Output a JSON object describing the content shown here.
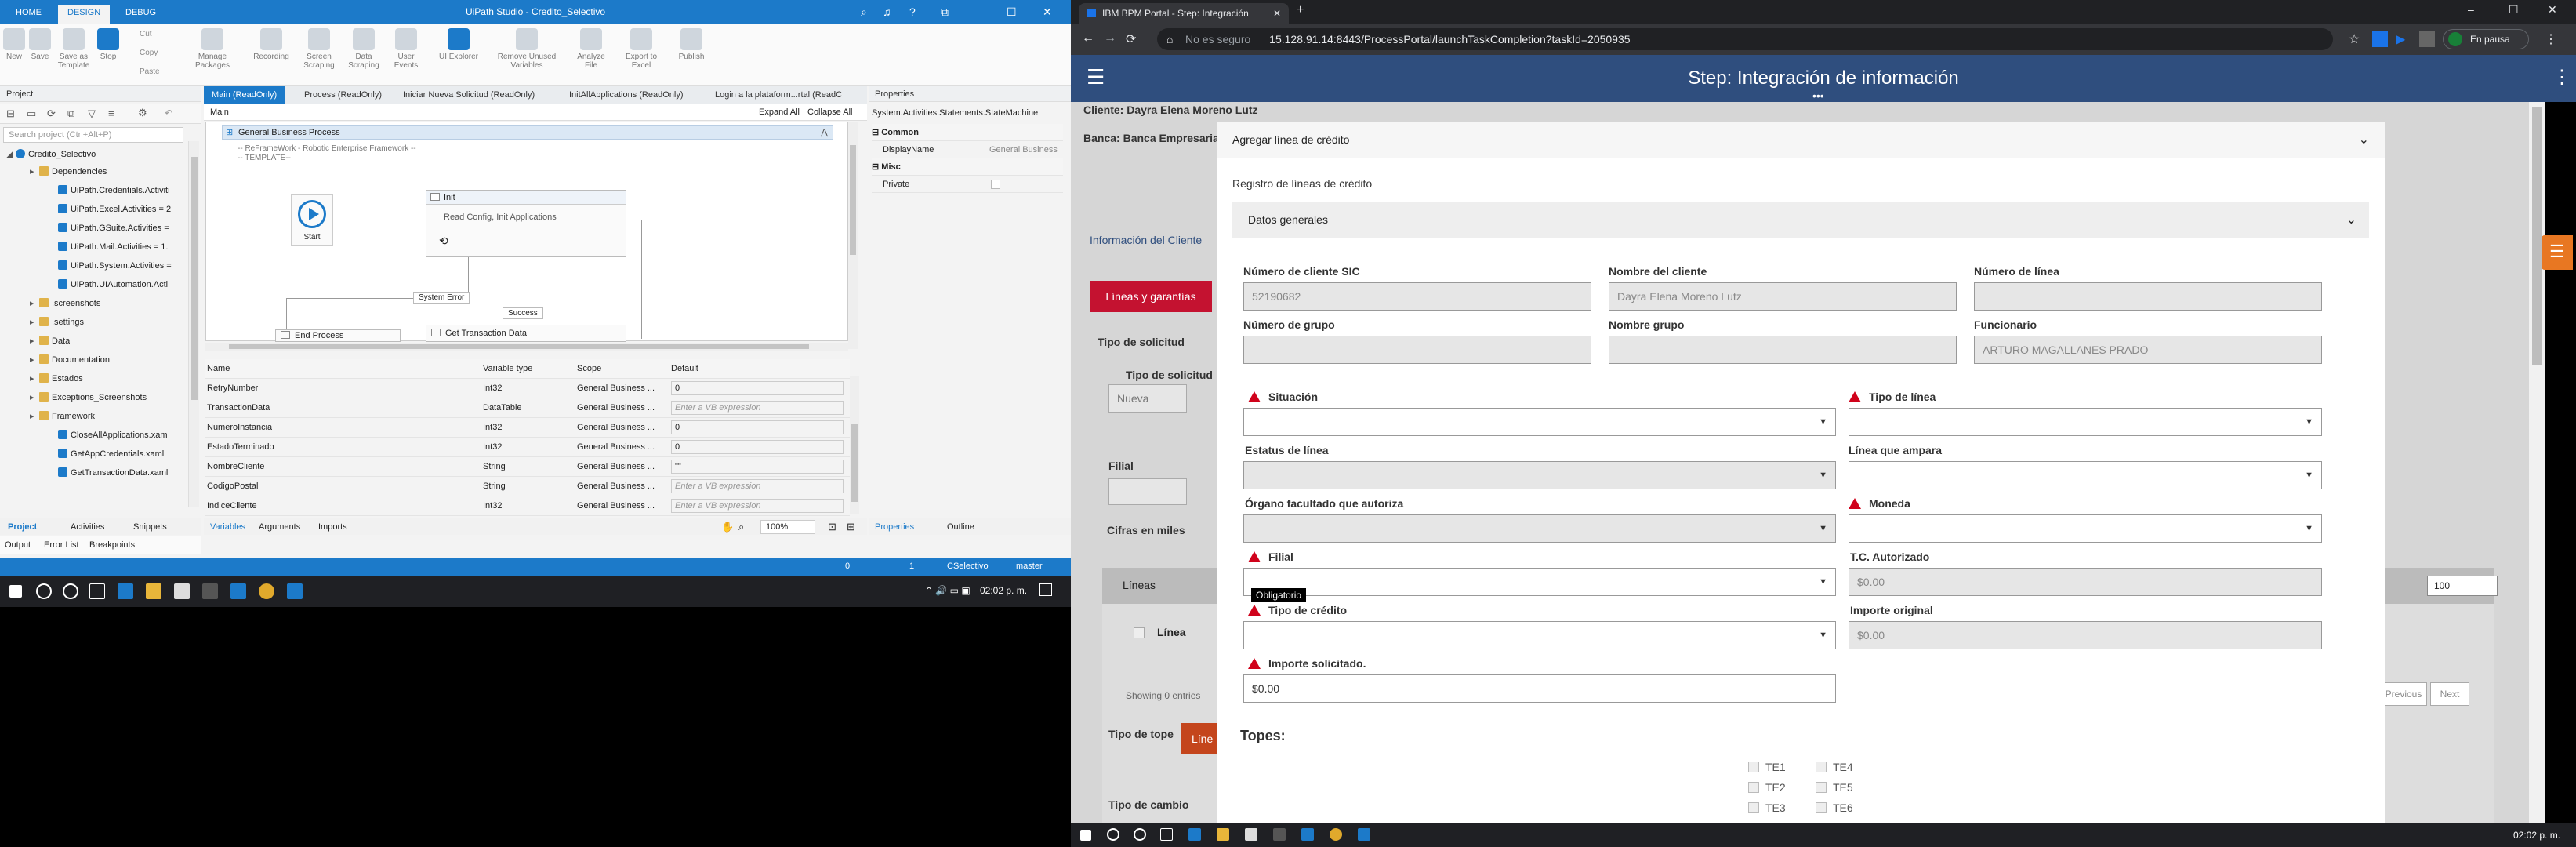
{
  "uipath": {
    "tabs": [
      "HOME",
      "DESIGN",
      "DEBUG"
    ],
    "title": "UiPath Studio - Credito_Selectivo",
    "ribbon": {
      "new": "New",
      "save": "Save",
      "save_as": "Save as Template",
      "stop": "Stop",
      "cut": "Cut",
      "copy": "Copy",
      "paste": "Paste",
      "manage": "Manage Packages",
      "recording": "Recording",
      "screen": "Screen Scraping",
      "data": "Data Scraping",
      "user": "User Events",
      "explorer": "UI Explorer",
      "remove": "Remove Unused Variables",
      "analyze": "Analyze File",
      "export": "Export to Excel",
      "publish": "Publish"
    },
    "project": {
      "header": "Project",
      "search": "Search project (Ctrl+Alt+P)",
      "root": "Credito_Selectivo",
      "items": [
        {
          "label": "Dependencies",
          "kind": "fold",
          "level": 1
        },
        {
          "label": "UiPath.Credentials.Activiti",
          "kind": "pkg",
          "level": 2
        },
        {
          "label": "UiPath.Excel.Activities = 2",
          "kind": "pkg",
          "level": 2
        },
        {
          "label": "UiPath.GSuite.Activities =",
          "kind": "pkg",
          "level": 2
        },
        {
          "label": "UiPath.Mail.Activities = 1.",
          "kind": "pkg",
          "level": 2
        },
        {
          "label": "UiPath.System.Activities =",
          "kind": "pkg",
          "level": 2
        },
        {
          "label": "UiPath.UIAutomation.Acti",
          "kind": "pkg",
          "level": 2
        },
        {
          "label": ".screenshots",
          "kind": "fold",
          "level": 1
        },
        {
          "label": ".settings",
          "kind": "fold",
          "level": 1
        },
        {
          "label": "Data",
          "kind": "fold",
          "level": 1
        },
        {
          "label": "Documentation",
          "kind": "fold",
          "level": 1
        },
        {
          "label": "Estados",
          "kind": "fold",
          "level": 1
        },
        {
          "label": "Exceptions_Screenshots",
          "kind": "fold",
          "level": 1
        },
        {
          "label": "Framework",
          "kind": "fold",
          "level": 1
        },
        {
          "label": "CloseAllApplications.xam",
          "kind": "xaml",
          "level": 2
        },
        {
          "label": "GetAppCredentials.xaml",
          "kind": "xaml",
          "level": 2
        },
        {
          "label": "GetTransactionData.xaml",
          "kind": "xaml",
          "level": 2
        }
      ],
      "bottom_tabs": [
        "Project",
        "Activities",
        "Snippets"
      ],
      "footer_tabs": [
        "Output",
        "Error List",
        "Breakpoints"
      ]
    },
    "doc_tabs": [
      "Main (ReadOnly)",
      "Process (ReadOnly)",
      "Iniciar Nueva Solicitud (ReadOnly)",
      "InitAllApplications (ReadOnly)",
      "Login a la plataform...rtal (ReadC"
    ],
    "breadcrumb": "Main",
    "expand_all": "Expand All",
    "collapse_all": "Collapse All",
    "workflow": {
      "container": "General Business Process",
      "comment1": "-- ReFrameWork - Robotic Enterprise Framework --",
      "comment2": "-- TEMPLATE--",
      "start": "Start",
      "init_title": "Init",
      "init_body": "Read Config, Init Applications",
      "system_error": "System Error",
      "success": "Success",
      "end": "End Process",
      "get": "Get Transaction Data"
    },
    "vars": {
      "headers": [
        "Name",
        "Variable type",
        "Scope",
        "Default"
      ],
      "rows": [
        [
          "RetryNumber",
          "Int32",
          "General Business ...",
          "0"
        ],
        [
          "TransactionData",
          "DataTable",
          "General Business ...",
          "Enter a VB expression"
        ],
        [
          "NumeroInstancia",
          "Int32",
          "General Business ...",
          "0"
        ],
        [
          "EstadoTerminado",
          "Int32",
          "General Business ...",
          "0"
        ],
        [
          "NombreCliente",
          "String",
          "General Business ...",
          "\"\""
        ],
        [
          "CodigoPostal",
          "String",
          "General Business ...",
          "Enter a VB expression"
        ],
        [
          "IndiceCliente",
          "Int32",
          "General Business ...",
          "Enter a VB expression"
        ]
      ],
      "bottom_tabs": [
        "Variables",
        "Arguments",
        "Imports"
      ],
      "zoom": "100%"
    },
    "properties": {
      "header": "Properties",
      "type": "System.Activities.Statements.StateMachine",
      "common": "Common",
      "display_name_label": "DisplayName",
      "display_name_value": "General Business",
      "misc": "Misc",
      "private": "Private",
      "bottom_tabs": [
        "Properties",
        "Outline"
      ]
    },
    "status": {
      "errors": "0",
      "warnings": "1",
      "project": "CSelectivo",
      "branch": "master"
    },
    "clock": "02:02 p. m."
  },
  "browser": {
    "tab_title": "IBM BPM Portal - Step: Integración",
    "not_secure": "No es seguro",
    "url": "15.128.91.14:8443/ProcessPortal/launchTaskCompletion?taskId=2050935",
    "profile": "En pausa",
    "header_title": "Step: Integración de información",
    "bg": {
      "cliente_label": "Cliente:",
      "cliente_value": "Dayra Elena Moreno Lutz",
      "banca_label": "Banca:",
      "banca_value": "Banca Empresarial",
      "info_cliente": "Información del Cliente",
      "lineas_btn": "Líneas y garantías",
      "tipo_solicitud": "Tipo de solicitud",
      "tipo_solicitud2": "Tipo de solicitud",
      "nueva": "Nueva",
      "filial": "Filial",
      "cifras": "Cifras en miles",
      "lineas": "Líneas",
      "linea": "Línea",
      "showing": "Showing 0 entries",
      "tipo_tope": "Tipo de tope",
      "tipo_cambio": "Tipo de cambio",
      "prev": "Previous",
      "next": "Next",
      "page_size": "100",
      "lin_btn": "Líne"
    },
    "modal": {
      "title": "Agregar línea de crédito",
      "registro": "Registro de líneas de crédito",
      "datos": "Datos generales",
      "num_cliente_label": "Número de cliente SIC",
      "num_cliente_value": "52190682",
      "nombre_cliente_label": "Nombre del cliente",
      "nombre_cliente_value": "Dayra Elena Moreno Lutz",
      "num_linea_label": "Número de línea",
      "num_grupo_label": "Número de grupo",
      "nombre_grupo_label": "Nombre grupo",
      "funcionario_label": "Funcionario",
      "funcionario_value": "ARTURO MAGALLANES PRADO",
      "situacion_label": "Situación",
      "tipo_linea_label": "Tipo de línea",
      "estatus_label": "Estatus de línea",
      "linea_ampara_label": "Línea que ampara",
      "organo_label": "Órgano facultado que autoriza",
      "moneda_label": "Moneda",
      "filial_label": "Filial",
      "tc_label": "T.C. Autorizado",
      "tc_value": "$0.00",
      "tooltip": "Obligatorio",
      "tipo_credito_label": "Tipo de crédito",
      "importe_original_label": "Importe original",
      "importe_original_value": "$0.00",
      "importe_sol_label": "Importe solicitado.",
      "importe_sol_value": "$0.00",
      "topes": "Topes:",
      "te": [
        "TE1",
        "TE4",
        "TE2",
        "TE5",
        "TE3",
        "TE6"
      ]
    },
    "clock": "02:02 p. m."
  }
}
